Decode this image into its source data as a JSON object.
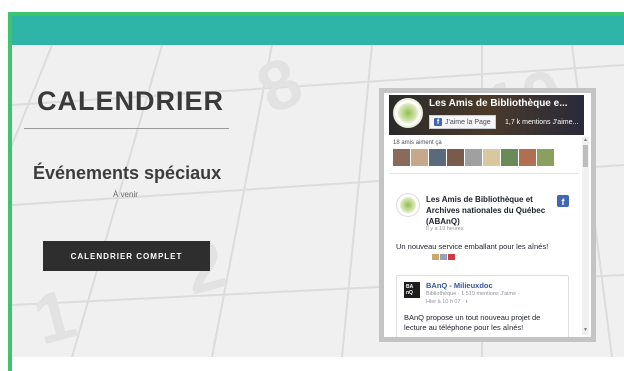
{
  "colors": {
    "accent_green": "#3ec46d",
    "teal_bar": "#2fb5a7",
    "button_dark": "#2e2e2e",
    "facebook_blue": "#4267b2"
  },
  "section": {
    "title": "CALENDRIER",
    "events_title": "Événements spéciaux",
    "events_subtitle": "À venir",
    "full_calendar_button": "CALENDRIER COMPLET"
  },
  "facebook": {
    "page_title": "Les Amis de Bibliothèque e...",
    "like_button": "J'aime la Page",
    "mentions": "1,7 k mentions J'aime...",
    "friends_like": "18 amis aiment ça",
    "post": {
      "author": "Les Amis de Bibliothèque et Archives nationales du Québec (ABAnQ)",
      "time": "Il y a 19 heures",
      "text": "Un nouveau service emballant pour les aînés!",
      "shared": {
        "logo_text": "BA nQ",
        "name": "BAnQ - Milieuxdoc",
        "meta": "Bibliothèque · 1 519 mentions J'aime ·",
        "time": "Hier à 10 h 07 · ",
        "text": "BAnQ propose un tout nouveau projet de lecture au téléphone pour les aînés!"
      }
    },
    "icons": [
      "facebook-f-icon",
      "globe-icon",
      "scroll-up-arrow-icon",
      "scroll-down-arrow-icon"
    ]
  }
}
